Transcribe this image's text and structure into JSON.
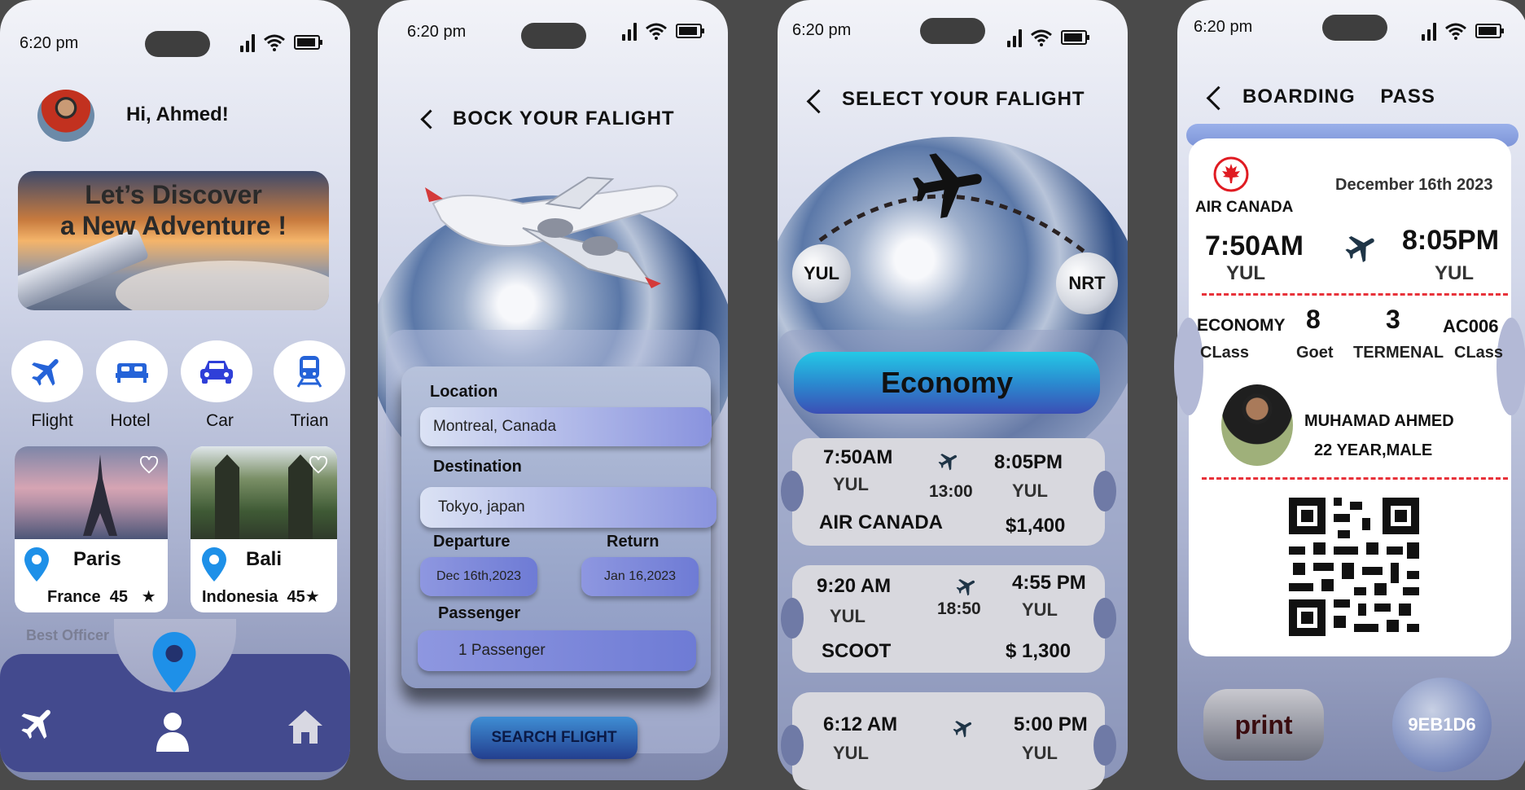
{
  "status": {
    "time": "6:20 pm"
  },
  "screen1": {
    "greeting": "Hi, Ahmed!",
    "banner_line1": "Let’s Discover",
    "banner_line2": "a New Adventure !",
    "categories": [
      {
        "label": "Flight",
        "icon": "airplane-icon"
      },
      {
        "label": "Hotel",
        "icon": "bed-icon"
      },
      {
        "label": "Car",
        "icon": "car-icon"
      },
      {
        "label": "Trian",
        "icon": "train-icon"
      }
    ],
    "destinations": [
      {
        "name": "Paris",
        "country": "France",
        "rating": "45",
        "star": "★"
      },
      {
        "name": "Bali",
        "country": "Indonesia",
        "rating": "45",
        "star": "★"
      }
    ],
    "section_label": "Best Officer",
    "nav": [
      "airplane-icon",
      "profile-icon",
      "home-icon"
    ]
  },
  "screen2": {
    "title": "BOCK  YOUR  FALIGHT",
    "location_label": "Location",
    "location_value": "Montreal, Canada",
    "destination_label": "Destination",
    "destination_value": "Tokyo, japan",
    "departure_label": "Departure",
    "departure_value": "Dec 16th,2023",
    "return_label": "Return",
    "return_value": "Jan 16,2023",
    "passenger_label": "Passenger",
    "passenger_value": "1 Passenger",
    "search_button": "SEARCH FLIGHT"
  },
  "screen3": {
    "title": "SELECT  YOUR  FALIGHT",
    "origin": "YUL",
    "destination": "NRT",
    "class_button": "Economy",
    "flights": [
      {
        "dep": "7:50AM",
        "from": "YUL",
        "arr": "8:05PM",
        "to": "YUL",
        "duration": "13:00",
        "airline": "AIR CANADA",
        "price": "$1,400"
      },
      {
        "dep": "9:20 AM",
        "from": "YUL",
        "arr": "4:55 PM",
        "to": "YUL",
        "duration": "18:50",
        "airline": "SCOOT",
        "price": "$ 1,300"
      },
      {
        "dep": "6:12 AM",
        "from": "YUL",
        "arr": "5:00 PM",
        "to": "YUL",
        "duration": "",
        "airline": "",
        "price": ""
      }
    ]
  },
  "screen4": {
    "title_a": "BOARDING",
    "title_b": "PASS",
    "airline": "AIR CANADA",
    "date": "December 16th 2023",
    "dep_time": "7:50AM",
    "dep_code": "YUL",
    "arr_time": "8:05PM",
    "arr_code": "YUL",
    "class_value": "ECONOMY",
    "class_label": "CLass",
    "gate_value": "8",
    "gate_label": "Goet",
    "terminal_value": "3",
    "terminal_label": "TERMENAL",
    "flight_value": "AC006",
    "flight_label": "CLass",
    "passenger_name": "MUHAMAD AHMED",
    "passenger_info": "22 YEAR,MALE",
    "print_button": "print",
    "code_button": "9EB1D6"
  },
  "colors": {
    "accent": "#2f6fd6",
    "navbar": "#434a8e",
    "dash_red": "#e8323a",
    "economy_cyan": "#24c9e6"
  }
}
